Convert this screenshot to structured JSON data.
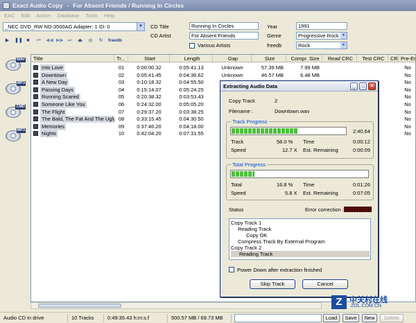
{
  "window": {
    "app_name": "Exact Audio Copy",
    "separator": "-",
    "document": "For Absent Friends / Running In Circles"
  },
  "menu": [
    "EAC",
    "Edit",
    "Action",
    "Database",
    "Tools",
    "Help"
  ],
  "drive": {
    "selected": "_NEC   DVD_RW ND-3500AG  Adapter: 1  ID: 0"
  },
  "toolbar": {
    "freedb_label": "freedb"
  },
  "cd_info": {
    "title_label": "CD Title",
    "title_value": "Running In Circles",
    "artist_label": "CD Artist",
    "artist_value": "For Absent Friends",
    "various_label": "Various Artists",
    "year_label": "Year",
    "year_value": "1991",
    "genre_label": "Genre",
    "genre_value": "Progressive Rock",
    "freedb_label": "freedb",
    "freedb_value": "Rock"
  },
  "sidebar": [
    "WAV",
    "MP3",
    "CMD",
    "MP3"
  ],
  "columns": [
    "Title",
    "Tr...",
    "Start",
    "Length",
    "Gap",
    "Size",
    "Compr. Size",
    "Read CRC",
    "Test CRC",
    "CRC",
    "Pre-Emphasis"
  ],
  "tracks": [
    {
      "title": "Into Love",
      "tr": "01",
      "start": "0:00:00.32",
      "length": "0:05:41.13",
      "gap": "Unknown",
      "size": "57.39 MB",
      "compr": "7.99 MB",
      "pre": "No"
    },
    {
      "title": "Downtown",
      "tr": "02",
      "start": "0:05:41.45",
      "length": "0:04:36.62",
      "gap": "Unknown",
      "size": "46.57 MB",
      "compr": "6.48 MB",
      "pre": "No"
    },
    {
      "title": "A New Day",
      "tr": "03",
      "start": "0:10:18.32",
      "length": "0:04:55.50",
      "gap": "Unknown",
      "size": "",
      "compr": "",
      "pre": "No"
    },
    {
      "title": "Passing Days",
      "tr": "04",
      "start": "0:15:14.07",
      "length": "0:05:24.25",
      "gap": "Unknown",
      "size": "",
      "compr": "",
      "pre": "No"
    },
    {
      "title": "Running Scared",
      "tr": "05",
      "start": "0:20:38.32",
      "length": "0:03:53.43",
      "gap": "Unknown",
      "size": "",
      "compr": "",
      "pre": "No"
    },
    {
      "title": "Someone Like You",
      "tr": "06",
      "start": "0:24:32.00",
      "length": "0:05:05.20",
      "gap": "Unknown",
      "size": "",
      "compr": "",
      "pre": "No"
    },
    {
      "title": "The Flight",
      "tr": "07",
      "start": "0:29:37.20",
      "length": "0:03:38.25",
      "gap": "Unknown",
      "size": "",
      "compr": "",
      "pre": "No"
    },
    {
      "title": "The Bald, The Fat And The Ugly",
      "tr": "08",
      "start": "0:33:15.45",
      "length": "0:04:30.50",
      "gap": "Unknown",
      "size": "",
      "compr": "",
      "pre": "No"
    },
    {
      "title": "Memories",
      "tr": "09",
      "start": "0:37:46.20",
      "length": "0:04:18.00",
      "gap": "Unknown",
      "size": "",
      "compr": "",
      "pre": "No"
    },
    {
      "title": "Nights",
      "tr": "10",
      "start": "0:42:04.20",
      "length": "0:07:31.55",
      "gap": "Unknown",
      "size": "",
      "compr": "",
      "pre": "No"
    }
  ],
  "dialog": {
    "title": "Extracting Audio Data",
    "copy_track_label": "Copy Track",
    "copy_track_value": "2",
    "filename_label": "Filename :",
    "filename_value": "Downtown.wav",
    "track_progress_label": "Track Progress",
    "track_progress_fraction": 0.58,
    "track_progress_time": "2:40.64",
    "track_label": "Track",
    "track_percent": "58.0 %",
    "time_label": "Time",
    "track_time": "0:00:12",
    "speed_label": "Speed",
    "track_speed": "12.7 X",
    "est_remaining_label": "Est. Remaining",
    "track_remaining": "0:00:09",
    "total_progress_label": "Total Progress",
    "total_progress_fraction": 0.168,
    "total_label": "Total",
    "total_percent": "16.8 %",
    "total_time": "0:01:26",
    "total_speed": "5.8 X",
    "total_remaining": "0:07:05",
    "status_label": "Status",
    "error_correction_label": "Error correction :",
    "log": [
      "Copy Track  1",
      "Reading Track",
      "Copy OK",
      "Compress Track By External Program",
      "Copy Track  2",
      "Reading Track"
    ],
    "power_down_label": "Power Down after extraction finished",
    "skip_button": "Skip Track",
    "cancel_button": "Cancel"
  },
  "status": {
    "cd_state": "Audio CD in drive",
    "tracks": "10 Tracks",
    "duration": "0:49:35.43 h:m:s.f",
    "size": "500.57 MB / 69.73 MB",
    "load": "Load",
    "save": "Save",
    "new": "New",
    "delete": "Delete"
  },
  "watermark": {
    "logo": "Z",
    "cn": "中关村在线",
    "url": "ZOL.COM.CN"
  }
}
